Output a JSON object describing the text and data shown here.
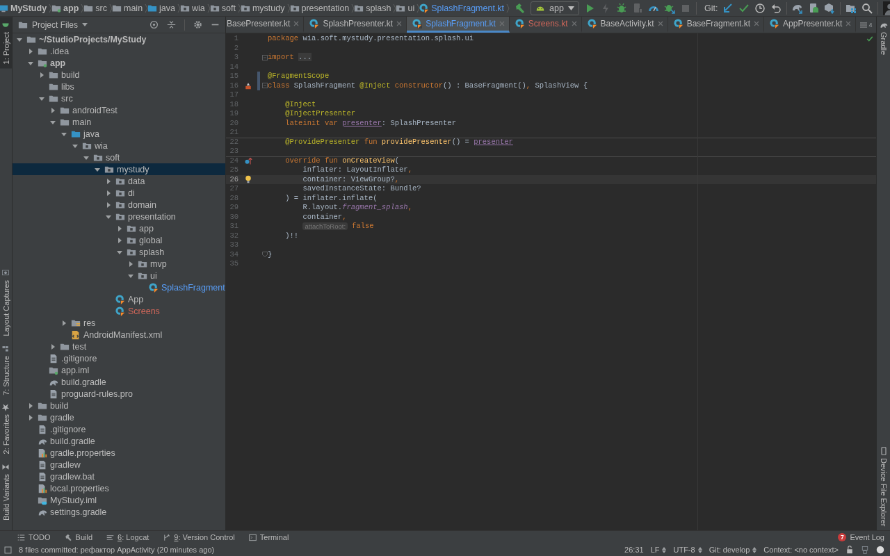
{
  "navbar": {
    "crumbs": [
      {
        "label": "MyStudy",
        "kind": "project"
      },
      {
        "label": "app",
        "kind": "module"
      },
      {
        "label": "src",
        "kind": "folder"
      },
      {
        "label": "main",
        "kind": "folder"
      },
      {
        "label": "java",
        "kind": "source"
      },
      {
        "label": "wia",
        "kind": "package"
      },
      {
        "label": "soft",
        "kind": "package"
      },
      {
        "label": "mystudy",
        "kind": "package"
      },
      {
        "label": "presentation",
        "kind": "package"
      },
      {
        "label": "splash",
        "kind": "package"
      },
      {
        "label": "ui",
        "kind": "package"
      },
      {
        "label": "SplashFragment.kt",
        "kind": "kotlin",
        "color": "#589df6"
      }
    ],
    "run_config": "app",
    "tools": [
      {
        "kind": "build",
        "disabled": false
      },
      {
        "kind": "config"
      },
      {
        "kind": "run",
        "disabled": false
      },
      {
        "kind": "apply",
        "disabled": true
      },
      {
        "kind": "debug",
        "disabled": false
      },
      {
        "kind": "attach",
        "disabled": true
      },
      {
        "kind": "profile",
        "disabled": false
      },
      {
        "kind": "attach-debugger",
        "disabled": false
      },
      {
        "kind": "stop",
        "disabled": true
      },
      {
        "kind": "git",
        "label": "Git:"
      },
      {
        "kind": "update",
        "disabled": false
      },
      {
        "kind": "commit",
        "disabled": false
      },
      {
        "kind": "history",
        "disabled": false
      },
      {
        "kind": "revert",
        "disabled": false
      },
      {
        "kind": "sync",
        "disabled": false
      },
      {
        "kind": "avd",
        "disabled": false
      },
      {
        "kind": "sdk",
        "disabled": false
      },
      {
        "kind": "structure",
        "disabled": false
      },
      {
        "kind": "search",
        "disabled": false
      },
      {
        "kind": "avatar"
      }
    ]
  },
  "left_stripe": {
    "top": [
      {
        "label": "1: Project",
        "kind": "project",
        "selected": true
      }
    ],
    "bottom": [
      {
        "label": "Layout Captures",
        "kind": "captures",
        "selected": false
      },
      {
        "label": "7: Structure",
        "kind": "structure",
        "selected": false
      },
      {
        "label": "2: Favorites",
        "kind": "favorites",
        "selected": false
      },
      {
        "label": "Build Variants",
        "kind": "variants",
        "selected": false
      }
    ]
  },
  "right_stripe": {
    "top": [
      {
        "label": "Gradle",
        "kind": "gradle",
        "selected": false
      }
    ],
    "bottom": [
      {
        "label": "Device File Explorer",
        "kind": "device",
        "selected": false
      }
    ]
  },
  "project_panel": {
    "title": "Project Files",
    "tree": [
      {
        "label": "~/StudioProjects/MyStudy",
        "kind": "root",
        "expanded": true,
        "selected": false,
        "children": [
          {
            "label": ".idea",
            "kind": "folder",
            "expanded": false,
            "selected": false
          },
          {
            "label": "app",
            "kind": "module",
            "expanded": true,
            "selected": false,
            "children": [
              {
                "label": "build",
                "kind": "folder",
                "expanded": false,
                "selected": false
              },
              {
                "label": "libs",
                "kind": "folder",
                "selected": false
              },
              {
                "label": "src",
                "kind": "folder",
                "expanded": true,
                "selected": false,
                "children": [
                  {
                    "label": "androidTest",
                    "kind": "folder",
                    "expanded": false,
                    "selected": false
                  },
                  {
                    "label": "main",
                    "kind": "folder",
                    "expanded": true,
                    "selected": false,
                    "children": [
                      {
                        "label": "java",
                        "kind": "source",
                        "expanded": true,
                        "selected": false,
                        "children": [
                          {
                            "label": "wia",
                            "kind": "package",
                            "expanded": true,
                            "selected": false,
                            "children": [
                              {
                                "label": "soft",
                                "kind": "package",
                                "expanded": true,
                                "selected": false,
                                "children": [
                                  {
                                    "label": "mystudy",
                                    "kind": "package",
                                    "expanded": true,
                                    "selected": true,
                                    "children": [
                                      {
                                        "label": "data",
                                        "kind": "package",
                                        "expanded": false,
                                        "selected": false
                                      },
                                      {
                                        "label": "di",
                                        "kind": "package",
                                        "expanded": false,
                                        "selected": false
                                      },
                                      {
                                        "label": "domain",
                                        "kind": "package",
                                        "expanded": false,
                                        "selected": false
                                      },
                                      {
                                        "label": "presentation",
                                        "kind": "package",
                                        "expanded": true,
                                        "selected": false,
                                        "children": [
                                          {
                                            "label": "app",
                                            "kind": "package",
                                            "expanded": false,
                                            "selected": false
                                          },
                                          {
                                            "label": "global",
                                            "kind": "package",
                                            "expanded": false,
                                            "selected": false
                                          },
                                          {
                                            "label": "splash",
                                            "kind": "package",
                                            "expanded": true,
                                            "selected": false,
                                            "children": [
                                              {
                                                "label": "mvp",
                                                "kind": "package",
                                                "expanded": false,
                                                "selected": false
                                              },
                                              {
                                                "label": "ui",
                                                "kind": "package",
                                                "expanded": true,
                                                "selected": false,
                                                "children": [
                                                  {
                                                    "label": "SplashFragment",
                                                    "kind": "kotlin",
                                                    "selected": false,
                                                    "color": "#589df6"
                                                  }
                                                ]
                                              }
                                            ]
                                          }
                                        ]
                                      },
                                      {
                                        "label": "App",
                                        "kind": "kotlin",
                                        "selected": false
                                      },
                                      {
                                        "label": "Screens",
                                        "kind": "kotlin",
                                        "selected": false,
                                        "color": "#d1675a"
                                      }
                                    ]
                                  }
                                ]
                              }
                            ]
                          }
                        ]
                      },
                      {
                        "label": "res",
                        "kind": "res",
                        "expanded": false,
                        "selected": false
                      },
                      {
                        "label": "AndroidManifest.xml",
                        "kind": "manifest",
                        "selected": false
                      }
                    ]
                  },
                  {
                    "label": "test",
                    "kind": "folder",
                    "expanded": false,
                    "selected": false
                  }
                ]
              },
              {
                "label": ".gitignore",
                "kind": "file",
                "selected": false
              },
              {
                "label": "app.iml",
                "kind": "iml",
                "selected": false
              },
              {
                "label": "build.gradle",
                "kind": "gradle",
                "selected": false
              },
              {
                "label": "proguard-rules.pro",
                "kind": "file",
                "selected": false
              }
            ]
          },
          {
            "label": "build",
            "kind": "folder",
            "expanded": false,
            "selected": false
          },
          {
            "label": "gradle",
            "kind": "folder",
            "expanded": false,
            "selected": false
          },
          {
            "label": ".gitignore",
            "kind": "file",
            "selected": false
          },
          {
            "label": "build.gradle",
            "kind": "gradle",
            "selected": false
          },
          {
            "label": "gradle.properties",
            "kind": "properties",
            "selected": false
          },
          {
            "label": "gradlew",
            "kind": "file",
            "selected": false
          },
          {
            "label": "gradlew.bat",
            "kind": "file",
            "selected": false
          },
          {
            "label": "local.properties",
            "kind": "properties",
            "selected": false
          },
          {
            "label": "MyStudy.iml",
            "kind": "project-iml",
            "selected": false
          },
          {
            "label": "settings.gradle",
            "kind": "gradle",
            "selected": false
          }
        ]
      }
    ]
  },
  "editor": {
    "tabs": [
      {
        "label": "BasePresenter.kt",
        "selected": false,
        "color": "#bbbbbb"
      },
      {
        "label": "SplashPresenter.kt",
        "selected": false,
        "color": "#bbbbbb"
      },
      {
        "label": "SplashFragment.kt",
        "selected": true,
        "color": "#589df6"
      },
      {
        "label": "Screens.kt",
        "selected": false,
        "color": "#d1675a"
      },
      {
        "label": "BaseActivity.kt",
        "selected": false,
        "color": "#bbbbbb"
      },
      {
        "label": "BaseFragment.kt",
        "selected": false,
        "color": "#bbbbbb"
      },
      {
        "label": "AppPresenter.kt",
        "selected": false,
        "color": "#bbbbbb"
      }
    ],
    "hidden_tabs": "4",
    "lines": [
      {
        "number": "1",
        "tokens": [
          {
            "text": "package ",
            "kind": "keyword"
          },
          {
            "text": "wia.soft.mystudy.presentation.splash.ui",
            "kind": "plain"
          }
        ],
        "changed": false,
        "current": false,
        "separator": false
      },
      {
        "number": "2",
        "changed": false,
        "current": false,
        "separator": false
      },
      {
        "number": "3",
        "tokens": [
          {
            "text": "import ",
            "kind": "keyword"
          },
          {
            "text": "...",
            "kind": "folded"
          }
        ],
        "fold_marker": {
          "kind": "start"
        },
        "changed": false,
        "current": false,
        "separator": false
      },
      {
        "number": "14",
        "changed": false,
        "current": false,
        "separator": false
      },
      {
        "number": "15",
        "tokens": [
          {
            "text": "@FragmentScope",
            "kind": "annotation"
          }
        ],
        "changed": true,
        "current": false,
        "separator": false
      },
      {
        "number": "16",
        "tokens": [
          {
            "text": "class ",
            "kind": "keyword"
          },
          {
            "text": "SplashFragment ",
            "kind": "plain"
          },
          {
            "text": "@Inject ",
            "kind": "annotation"
          },
          {
            "text": "constructor",
            "kind": "keyword"
          },
          {
            "text": "() : BaseFragment()",
            "kind": "plain"
          },
          {
            "text": ", ",
            "kind": "keyword"
          },
          {
            "text": "SplashView {",
            "kind": "plain"
          }
        ],
        "gutter_icon": {
          "kind": "layout"
        },
        "fold_marker": {
          "kind": "start"
        },
        "changed": true,
        "current": false,
        "separator": false
      },
      {
        "number": "17",
        "changed": false,
        "current": false,
        "separator": false
      },
      {
        "number": "18",
        "kind": "member",
        "tokens": [
          {
            "text": "@Inject",
            "kind": "annotation"
          }
        ],
        "changed": false,
        "current": false,
        "separator": false
      },
      {
        "number": "19",
        "kind": "member",
        "tokens": [
          {
            "text": "@InjectPresenter",
            "kind": "annotation"
          }
        ],
        "changed": false,
        "current": false,
        "separator": false
      },
      {
        "number": "20",
        "kind": "member",
        "tokens": [
          {
            "text": "lateinit var ",
            "kind": "keyword"
          },
          {
            "text": "presenter",
            "kind": "property"
          },
          {
            "text": ": SplashPresenter",
            "kind": "plain"
          }
        ],
        "changed": false,
        "current": false,
        "separator": false
      },
      {
        "number": "21",
        "changed": false,
        "current": false,
        "separator": false
      },
      {
        "number": "22",
        "kind": "member",
        "tokens": [
          {
            "text": "@ProvidePresenter ",
            "kind": "annotation"
          },
          {
            "text": "fun ",
            "kind": "keyword"
          },
          {
            "text": "providePresenter",
            "kind": "function"
          },
          {
            "text": "() = ",
            "kind": "plain"
          },
          {
            "text": "presenter",
            "kind": "property"
          }
        ],
        "changed": false,
        "current": false,
        "separator": true
      },
      {
        "number": "23",
        "changed": false,
        "current": false,
        "separator": false
      },
      {
        "number": "24",
        "kind": "member",
        "tokens": [
          {
            "text": "override fun ",
            "kind": "keyword"
          },
          {
            "text": "onCreateView",
            "kind": "function"
          },
          {
            "text": "(",
            "kind": "plain"
          }
        ],
        "gutter_icon": {
          "kind": "override"
        },
        "changed": false,
        "current": false,
        "separator": true
      },
      {
        "number": "25",
        "kind": "continuation",
        "tokens": [
          {
            "text": "inflater: LayoutInflater",
            "kind": "plain"
          },
          {
            "text": ",",
            "kind": "keyword"
          }
        ],
        "changed": false,
        "current": false,
        "separator": false
      },
      {
        "number": "26",
        "kind": "continuation",
        "tokens": [
          {
            "text": "container: ViewGroup?",
            "kind": "plain"
          },
          {
            "text": ",",
            "kind": "keyword"
          }
        ],
        "gutter_icon": {
          "kind": "intention"
        },
        "changed": false,
        "current": true,
        "separator": false
      },
      {
        "number": "27",
        "kind": "continuation",
        "tokens": [
          {
            "text": "savedInstanceState: Bundle?",
            "kind": "plain"
          }
        ],
        "changed": false,
        "current": false,
        "separator": false
      },
      {
        "number": "28",
        "kind": "member",
        "tokens": [
          {
            "text": ") = inflater.inflate(",
            "kind": "plain"
          }
        ],
        "changed": false,
        "current": false,
        "separator": false
      },
      {
        "number": "29",
        "kind": "continuation",
        "tokens": [
          {
            "text": "R.layout.",
            "kind": "plain"
          },
          {
            "text": "fragment_splash",
            "kind": "field"
          },
          {
            "text": ",",
            "kind": "keyword"
          }
        ],
        "changed": false,
        "current": false,
        "separator": false
      },
      {
        "number": "30",
        "kind": "continuation",
        "tokens": [
          {
            "text": "container",
            "kind": "plain"
          },
          {
            "text": ",",
            "kind": "keyword"
          }
        ],
        "changed": false,
        "current": false,
        "separator": false
      },
      {
        "number": "31",
        "kind": "continuation",
        "tokens": [
          {
            "text": "attachToRoot:",
            "kind": "hint"
          },
          {
            "text": "false",
            "kind": "keyword"
          }
        ],
        "changed": false,
        "current": false,
        "separator": false
      },
      {
        "number": "32",
        "kind": "member",
        "tokens": [
          {
            "text": ")!!",
            "kind": "plain"
          }
        ],
        "changed": false,
        "current": false,
        "separator": false
      },
      {
        "number": "33",
        "changed": false,
        "current": false,
        "separator": false
      },
      {
        "number": "34",
        "tokens": [
          {
            "text": "}",
            "kind": "plain"
          }
        ],
        "fold_marker": {
          "kind": "end"
        },
        "changed": false,
        "current": false,
        "separator": false
      },
      {
        "number": "35",
        "changed": false,
        "current": false,
        "separator": false
      }
    ]
  },
  "bottom_tools": {
    "left": [
      {
        "label": "TODO",
        "kind": "todo",
        "mnemonic": false
      },
      {
        "label": "Build",
        "kind": "build",
        "mnemonic": false
      },
      {
        "label": "6: Logcat",
        "kind": "logcat",
        "mnemonic": true
      },
      {
        "label": "9: Version Control",
        "kind": "vcs",
        "mnemonic": true
      },
      {
        "label": "Terminal",
        "kind": "terminal",
        "mnemonic": false
      }
    ],
    "event_log": {
      "label": "Event Log",
      "count": "7"
    }
  },
  "status_bar": {
    "message": "8 files committed: рефактор AppActivity (20 minutes ago)",
    "fields": [
      {
        "label": "26:31",
        "kind": "plain"
      },
      {
        "label": "LF",
        "kind": "choice"
      },
      {
        "label": "UTF-8",
        "kind": "choice"
      },
      {
        "label": "Git: develop",
        "kind": "choice"
      },
      {
        "label": "Context: <no context>",
        "kind": "plain"
      }
    ]
  }
}
